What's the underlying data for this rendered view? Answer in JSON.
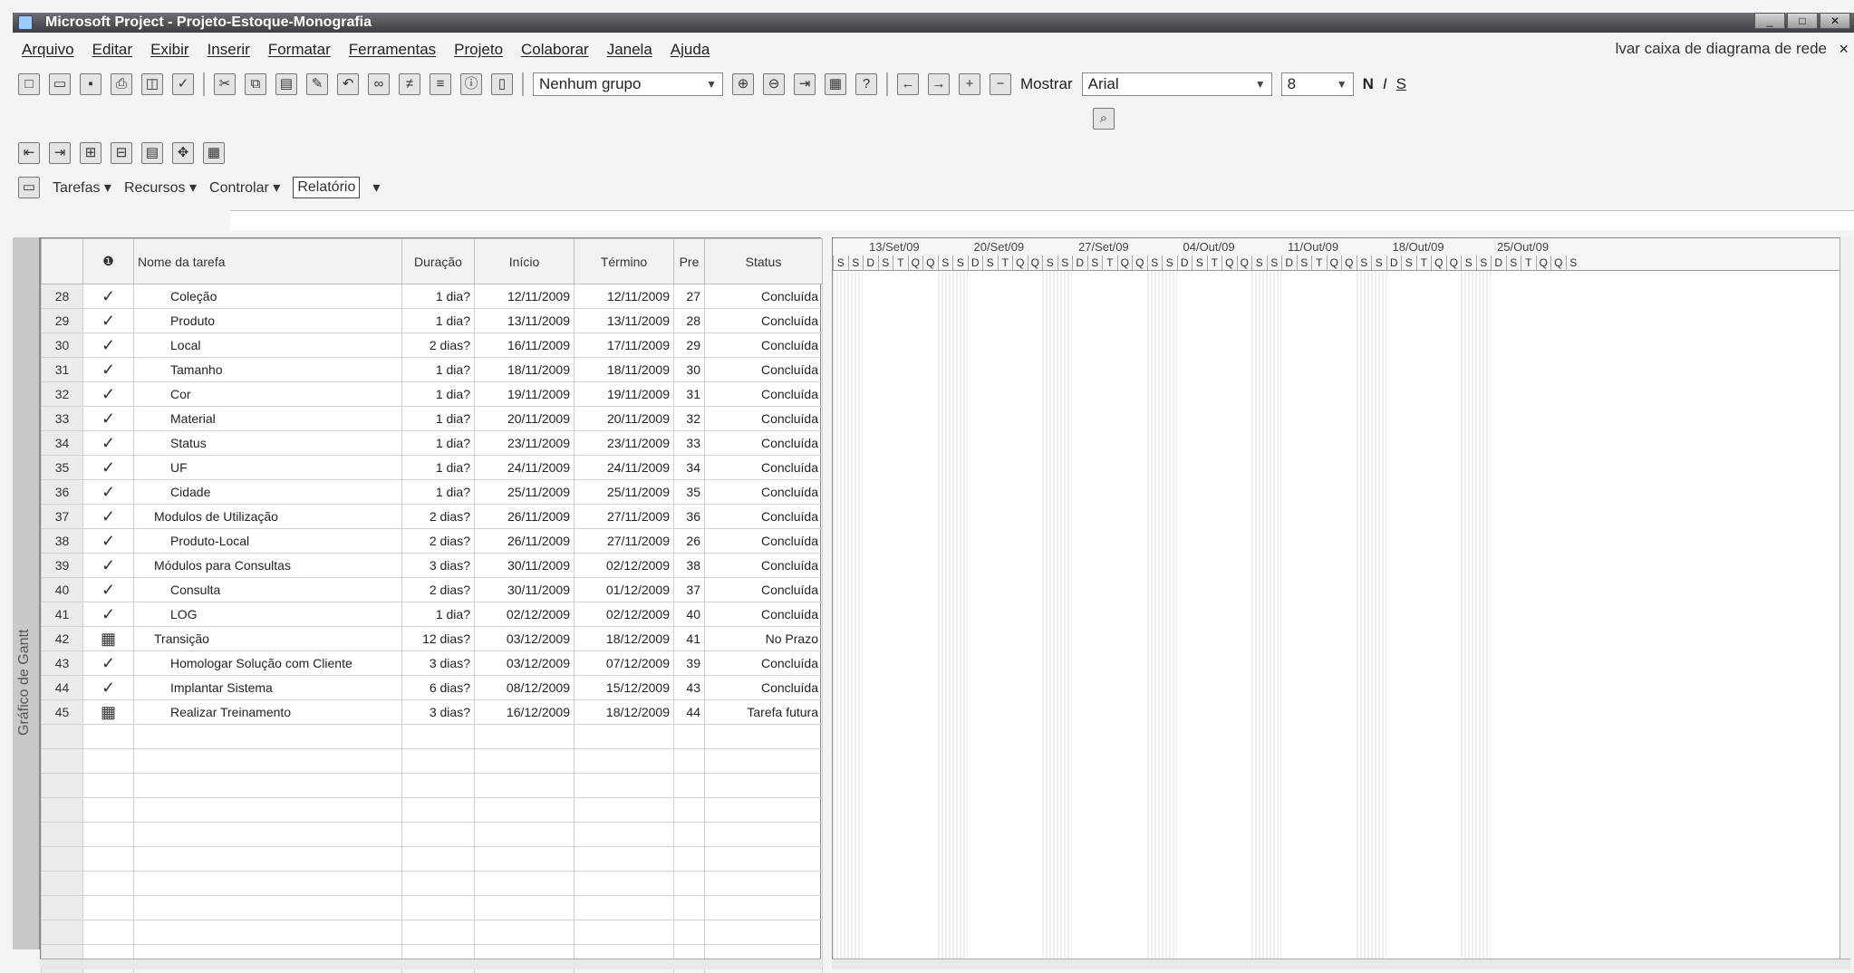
{
  "window": {
    "title": "Microsoft Project - Projeto-Estoque-Monografia"
  },
  "menu": {
    "items": [
      "Arquivo",
      "Editar",
      "Exibir",
      "Inserir",
      "Formatar",
      "Ferramentas",
      "Projeto",
      "Colaborar",
      "Janela",
      "Ajuda"
    ],
    "help_box": "lvar caixa de diagrama de rede",
    "close": "×"
  },
  "toolbar": {
    "group_dropdown": "Nenhum grupo",
    "show_label": "Mostrar",
    "font_name": "Arial",
    "font_size": "8",
    "bold": "N",
    "italic": "I",
    "underline": "S"
  },
  "nav": {
    "tasks": "Tarefas",
    "resources": "Recursos",
    "track": "Controlar",
    "report": "Relatório"
  },
  "side_label": "Gráfico de Gantt",
  "table": {
    "headers": [
      "",
      "",
      "Nome da tarefa",
      "Duração",
      "Início",
      "Término",
      "Pre",
      "Status"
    ],
    "rows": [
      {
        "id": "28",
        "ind": "check",
        "name": "Coleção",
        "indent": 2,
        "dur": "1 dia?",
        "start": "12/11/2009",
        "end": "12/11/2009",
        "pred": "27",
        "status": "Concluída"
      },
      {
        "id": "29",
        "ind": "check",
        "name": "Produto",
        "indent": 2,
        "dur": "1 dia?",
        "start": "13/11/2009",
        "end": "13/11/2009",
        "pred": "28",
        "status": "Concluída"
      },
      {
        "id": "30",
        "ind": "check",
        "name": "Local",
        "indent": 2,
        "dur": "2 dias?",
        "start": "16/11/2009",
        "end": "17/11/2009",
        "pred": "29",
        "status": "Concluída"
      },
      {
        "id": "31",
        "ind": "check",
        "name": "Tamanho",
        "indent": 2,
        "dur": "1 dia?",
        "start": "18/11/2009",
        "end": "18/11/2009",
        "pred": "30",
        "status": "Concluída"
      },
      {
        "id": "32",
        "ind": "check",
        "name": "Cor",
        "indent": 2,
        "dur": "1 dia?",
        "start": "19/11/2009",
        "end": "19/11/2009",
        "pred": "31",
        "status": "Concluída"
      },
      {
        "id": "33",
        "ind": "check",
        "name": "Material",
        "indent": 2,
        "dur": "1 dia?",
        "start": "20/11/2009",
        "end": "20/11/2009",
        "pred": "32",
        "status": "Concluída"
      },
      {
        "id": "34",
        "ind": "check",
        "name": "Status",
        "indent": 2,
        "dur": "1 dia?",
        "start": "23/11/2009",
        "end": "23/11/2009",
        "pred": "33",
        "status": "Concluída"
      },
      {
        "id": "35",
        "ind": "check",
        "name": "UF",
        "indent": 2,
        "dur": "1 dia?",
        "start": "24/11/2009",
        "end": "24/11/2009",
        "pred": "34",
        "status": "Concluída"
      },
      {
        "id": "36",
        "ind": "check",
        "name": "Cidade",
        "indent": 2,
        "dur": "1 dia?",
        "start": "25/11/2009",
        "end": "25/11/2009",
        "pred": "35",
        "status": "Concluída"
      },
      {
        "id": "37",
        "ind": "check",
        "name": "Modulos de Utilização",
        "indent": 1,
        "dur": "2 dias?",
        "start": "26/11/2009",
        "end": "27/11/2009",
        "pred": "36",
        "status": "Concluída"
      },
      {
        "id": "38",
        "ind": "check",
        "name": "Produto-Local",
        "indent": 2,
        "dur": "2 dias?",
        "start": "26/11/2009",
        "end": "27/11/2009",
        "pred": "26",
        "status": "Concluída"
      },
      {
        "id": "39",
        "ind": "check",
        "name": "Módulos para Consultas",
        "indent": 1,
        "dur": "3 dias?",
        "start": "30/11/2009",
        "end": "02/12/2009",
        "pred": "38",
        "status": "Concluída"
      },
      {
        "id": "40",
        "ind": "check",
        "name": "Consulta",
        "indent": 2,
        "dur": "2 dias?",
        "start": "30/11/2009",
        "end": "01/12/2009",
        "pred": "37",
        "status": "Concluída"
      },
      {
        "id": "41",
        "ind": "check",
        "name": "LOG",
        "indent": 2,
        "dur": "1 dia?",
        "start": "02/12/2009",
        "end": "02/12/2009",
        "pred": "40",
        "status": "Concluída"
      },
      {
        "id": "42",
        "ind": "grid",
        "name": "Transição",
        "indent": 1,
        "dur": "12 dias?",
        "start": "03/12/2009",
        "end": "18/12/2009",
        "pred": "41",
        "status": "No Prazo"
      },
      {
        "id": "43",
        "ind": "check",
        "name": "Homologar Solução com Cliente",
        "indent": 2,
        "dur": "3 dias?",
        "start": "03/12/2009",
        "end": "07/12/2009",
        "pred": "39",
        "status": "Concluída"
      },
      {
        "id": "44",
        "ind": "check",
        "name": "Implantar Sistema",
        "indent": 2,
        "dur": "6 dias?",
        "start": "08/12/2009",
        "end": "15/12/2009",
        "pred": "43",
        "status": "Concluída"
      },
      {
        "id": "45",
        "ind": "grid",
        "name": "Realizar Treinamento",
        "indent": 2,
        "dur": "3 dias?",
        "start": "16/12/2009",
        "end": "18/12/2009",
        "pred": "44",
        "status": "Tarefa futura"
      }
    ]
  },
  "gantt": {
    "weeks": [
      "13/Set/09",
      "20/Set/09",
      "27/Set/09",
      "04/Out/09",
      "11/Out/09",
      "18/Out/09",
      "25/Out/09"
    ],
    "days": [
      "S",
      "S",
      "D",
      "S",
      "T",
      "Q",
      "Q",
      "S",
      "S",
      "D",
      "S",
      "T",
      "Q",
      "Q",
      "S",
      "S",
      "D",
      "S",
      "T",
      "Q",
      "Q",
      "S",
      "S",
      "D",
      "S",
      "T",
      "Q",
      "Q",
      "S",
      "S",
      "D",
      "S",
      "T",
      "Q",
      "Q",
      "S",
      "S",
      "D",
      "S",
      "T",
      "Q",
      "Q",
      "S",
      "S",
      "D",
      "S",
      "T",
      "Q",
      "Q",
      "S"
    ]
  }
}
